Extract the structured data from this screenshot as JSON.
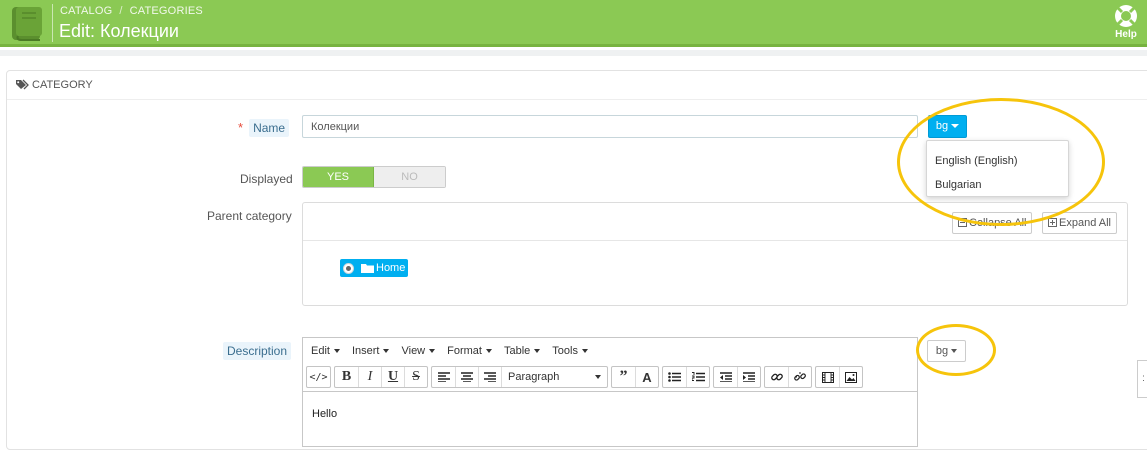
{
  "header": {
    "breadcrumb": [
      "CATALOG",
      "CATEGORIES"
    ],
    "title": "Edit: Колекции",
    "help_label": "Help"
  },
  "panel": {
    "heading": "CATEGORY"
  },
  "form": {
    "name_label": "Name",
    "required_mark": "*",
    "name_value": "Колекции",
    "lang_selected": "bg",
    "lang_options": [
      "English (English)",
      "Bulgarian"
    ],
    "displayed_label": "Displayed",
    "displayed_yes": "YES",
    "displayed_no": "NO",
    "parent_label": "Parent category",
    "collapse_all": "Collapse All",
    "expand_all": "Expand All",
    "home_node": "Home",
    "description_label": "Description",
    "description_lang": "bg"
  },
  "editor": {
    "menus": [
      "Edit",
      "Insert",
      "View",
      "Format",
      "Table",
      "Tools"
    ],
    "format_select": "Paragraph",
    "content": "Hello"
  },
  "colors": {
    "header_green": "#8bc954",
    "accent_blue": "#00aff0",
    "highlight_yellow": "#f6c40b"
  }
}
